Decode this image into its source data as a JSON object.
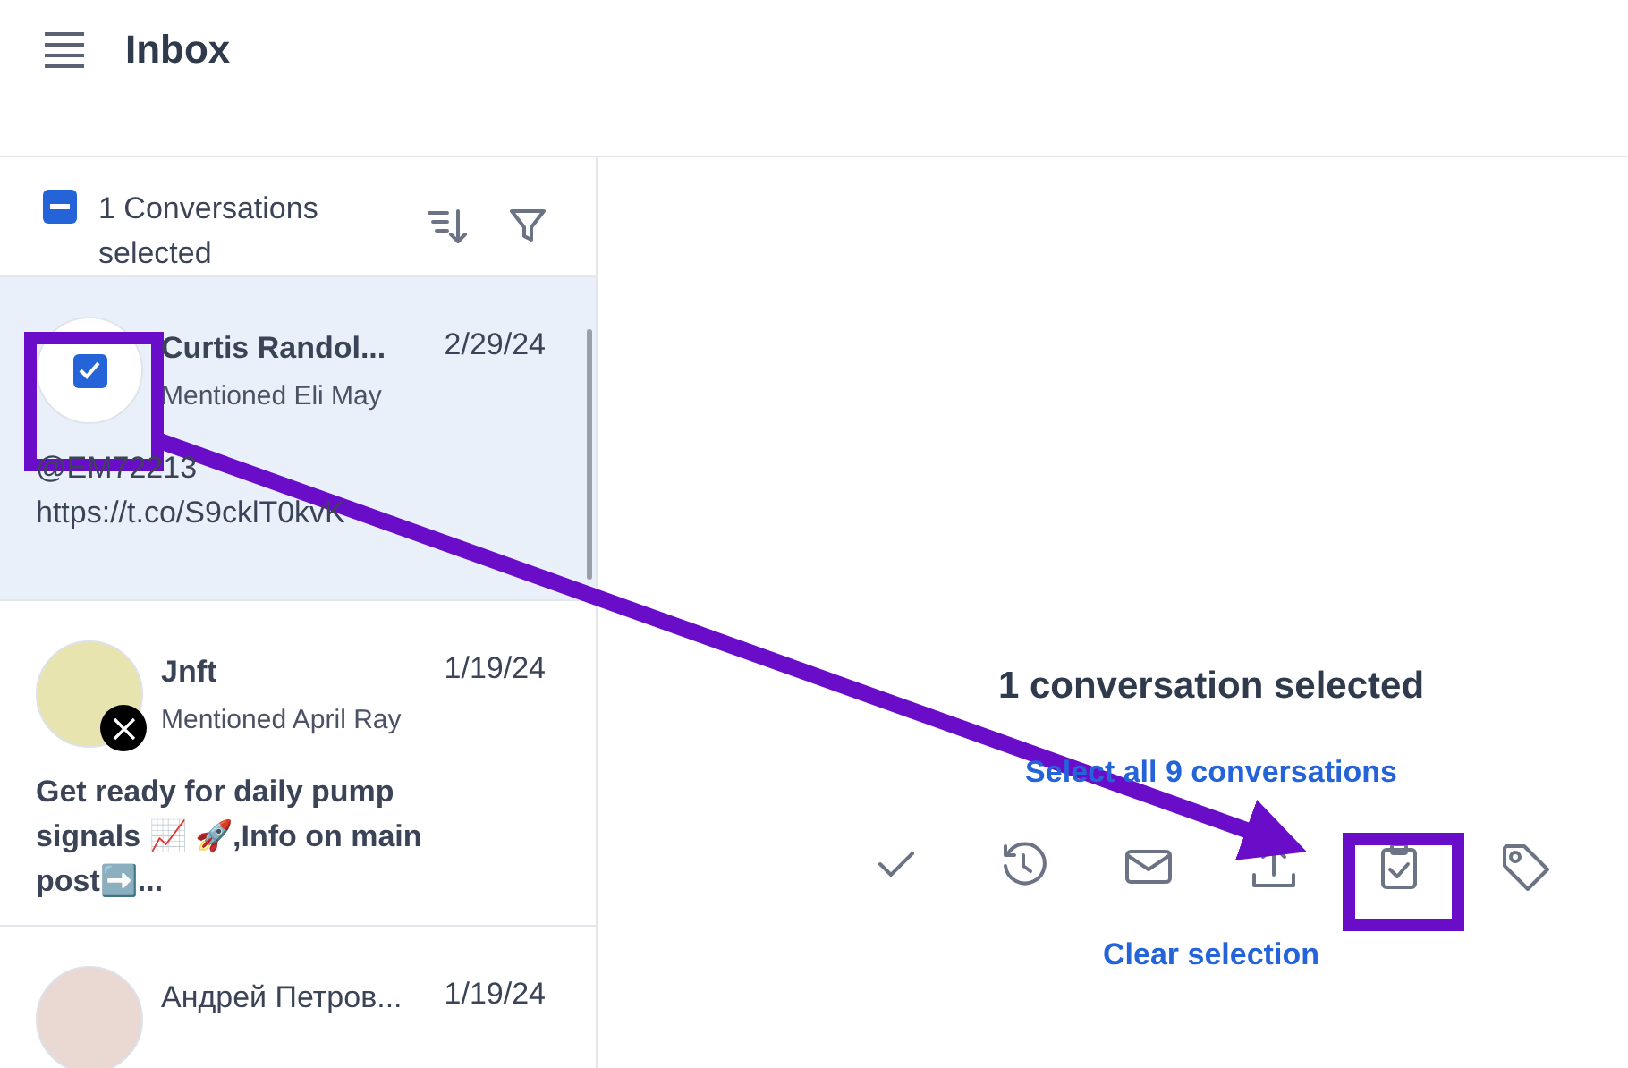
{
  "header": {
    "title": "Inbox"
  },
  "list_header": {
    "indeterminate": true,
    "label": "1 Conversations selected"
  },
  "conversations": [
    {
      "name": "Curtis Randol...",
      "date": "2/29/24",
      "subtitle": "Mentioned Eli May",
      "preview": "@EM72213 https://t.co/S9cklT0kvK",
      "selected": true,
      "checked": true,
      "unread": false
    },
    {
      "name": "Jnft",
      "date": "1/19/24",
      "subtitle": "Mentioned April Ray",
      "preview": "Get ready for daily pump signals 📈 🚀,Info on main post➡️...",
      "selected": false,
      "checked": false,
      "unread": true
    },
    {
      "name": "Андрей Петров...",
      "date": "1/19/24",
      "selected": false,
      "checked": false,
      "unread": false
    }
  ],
  "selection_panel": {
    "title": "1 conversation selected",
    "select_all_link": "Select all 9 conversations",
    "actions": [
      {
        "kind": "check"
      },
      {
        "kind": "history"
      },
      {
        "kind": "mail"
      },
      {
        "kind": "export"
      },
      {
        "kind": "clipboard"
      },
      {
        "kind": "tag"
      }
    ],
    "clear_link": "Clear selection"
  }
}
